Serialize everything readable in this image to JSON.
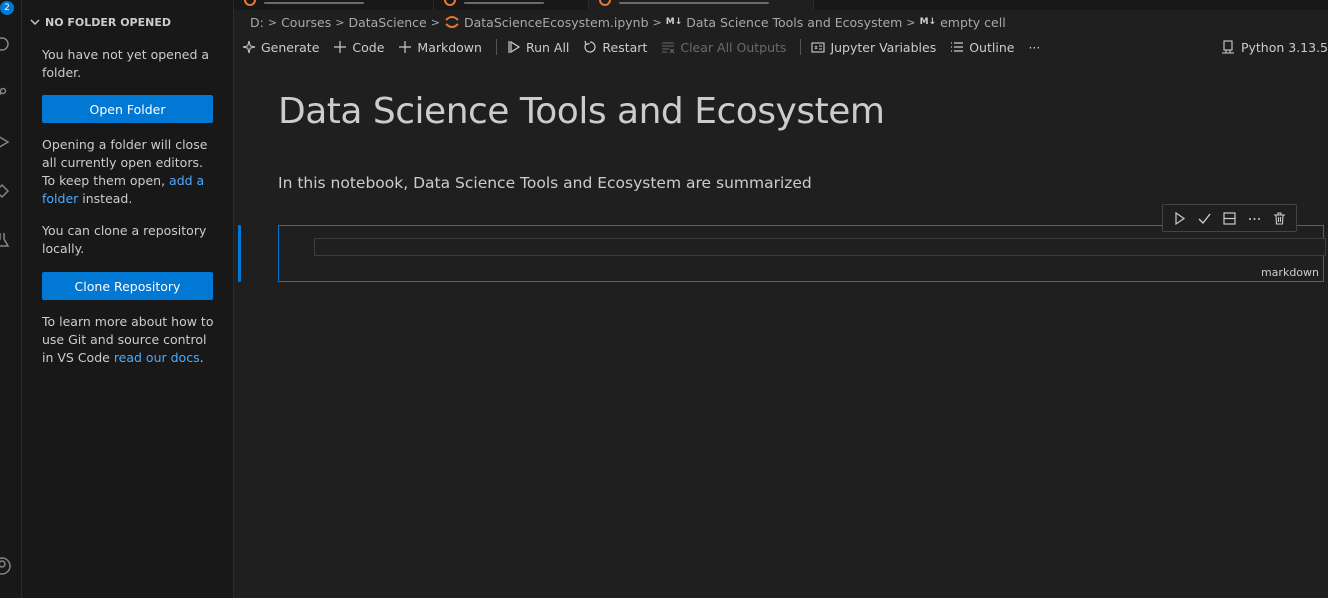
{
  "activity": {
    "badge": "2"
  },
  "sidebar": {
    "header": "NO FOLDER OPENED",
    "msg1": "You have not yet opened a folder.",
    "open_folder": "Open Folder",
    "msg2_pre": "Opening a folder will close all currently open editors. To keep them open, ",
    "msg2_link": "add a folder",
    "msg2_post": " instead.",
    "msg3": "You can clone a repository locally.",
    "clone_repo": "Clone Repository",
    "msg4_pre": "To learn more about how to use Git and source control in VS Code ",
    "msg4_link": "read our docs",
    "msg4_post": "."
  },
  "breadcrumb": {
    "drive": "D:",
    "folder1": "Courses",
    "folder2": "DataScience",
    "file": "DataScienceEcosystem.ipynb",
    "md_badge": "M↓",
    "section": "Data Science Tools and Ecosystem",
    "cell": "empty cell"
  },
  "toolbar": {
    "generate": "Generate",
    "code": "Code",
    "markdown": "Markdown",
    "run_all": "Run All",
    "restart": "Restart",
    "clear_outputs": "Clear All Outputs",
    "variables": "Jupyter Variables",
    "outline": "Outline",
    "more": "···",
    "kernel": "Python 3.13.5"
  },
  "notebook": {
    "title": "Data Science Tools and Ecosystem",
    "paragraph": "In this notebook, Data Science Tools and Ecosystem are summarized",
    "cell_language": "markdown"
  },
  "colors": {
    "accent": "#0078d4",
    "link": "#4daafc",
    "jupyter": "#e37933"
  }
}
